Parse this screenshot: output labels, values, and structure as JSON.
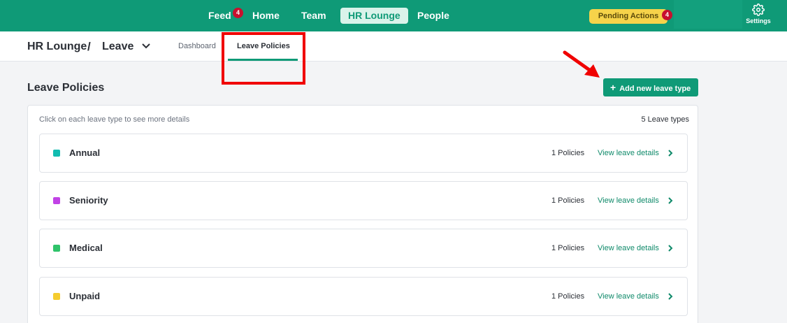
{
  "nav": {
    "items": [
      {
        "label": "Feed",
        "badge": "4"
      },
      {
        "label": "Home"
      },
      {
        "label": "Team"
      },
      {
        "label": "HR Lounge",
        "active": true
      },
      {
        "label": "People"
      }
    ],
    "pending": {
      "label": "Pending Actions",
      "badge": "4"
    },
    "settings_label": "Settings",
    "brand_color": "#0f9a77",
    "badge_color": "#c8102e",
    "pending_color": "#f6d34a"
  },
  "subheader": {
    "breadcrumb_root": "HR Lounge",
    "breadcrumb_sep": "/",
    "breadcrumb_current": "Leave",
    "tabs": [
      {
        "label": "Dashboard"
      },
      {
        "label": "Leave Policies",
        "active": true
      }
    ]
  },
  "main": {
    "title": "Leave Policies",
    "add_button": "Add new leave type",
    "hint": "Click on each leave type to see more details",
    "count": "5 Leave types",
    "leave_types": [
      {
        "name": "Annual",
        "color": "#12bcb0",
        "policies": "1 Policies",
        "link": "View leave details"
      },
      {
        "name": "Seniority",
        "color": "#c142e6",
        "policies": "1 Policies",
        "link": "View leave details"
      },
      {
        "name": "Medical",
        "color": "#2fc36a",
        "policies": "1 Policies",
        "link": "View leave details"
      },
      {
        "name": "Unpaid",
        "color": "#f5cc2f",
        "policies": "1 Policies",
        "link": "View leave details"
      }
    ]
  },
  "annotation_color": "#f00000"
}
